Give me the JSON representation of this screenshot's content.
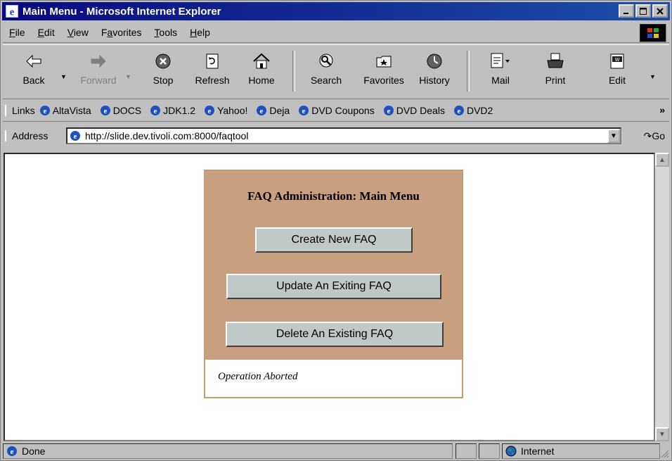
{
  "window": {
    "title": "Main Menu - Microsoft Internet Explorer"
  },
  "menu": [
    {
      "label": "File",
      "key": "F",
      "rest": "ile"
    },
    {
      "label": "Edit",
      "key": "E",
      "rest": "dit"
    },
    {
      "label": "View",
      "key": "V",
      "rest": "iew"
    },
    {
      "label": "Favorites",
      "key": "a",
      "pre": "F",
      "rest": "vorites"
    },
    {
      "label": "Tools",
      "key": "T",
      "rest": "ools"
    },
    {
      "label": "Help",
      "key": "H",
      "rest": "elp"
    }
  ],
  "toolbar": {
    "back": "Back",
    "forward": "Forward",
    "stop": "Stop",
    "refresh": "Refresh",
    "home": "Home",
    "search": "Search",
    "favorites": "Favorites",
    "history": "History",
    "mail": "Mail",
    "print": "Print",
    "edit": "Edit"
  },
  "links": {
    "label": "Links",
    "items": [
      "AltaVista",
      "DOCS",
      "JDK1.2",
      "Yahoo!",
      "Deja",
      "DVD Coupons",
      "DVD Deals",
      "DVD2"
    ]
  },
  "address": {
    "label": "Address",
    "url": "http://slide.dev.tivoli.com:8000/faqtool",
    "go": "Go"
  },
  "page": {
    "heading": "FAQ Administration: Main Menu",
    "buttons": {
      "create": "Create New FAQ",
      "update": "Update An Exiting FAQ",
      "delete": "Delete An Existing FAQ"
    },
    "message": "Operation Aborted",
    "panel_color": "#c8a080"
  },
  "status": {
    "text": "Done",
    "zone": "Internet"
  }
}
